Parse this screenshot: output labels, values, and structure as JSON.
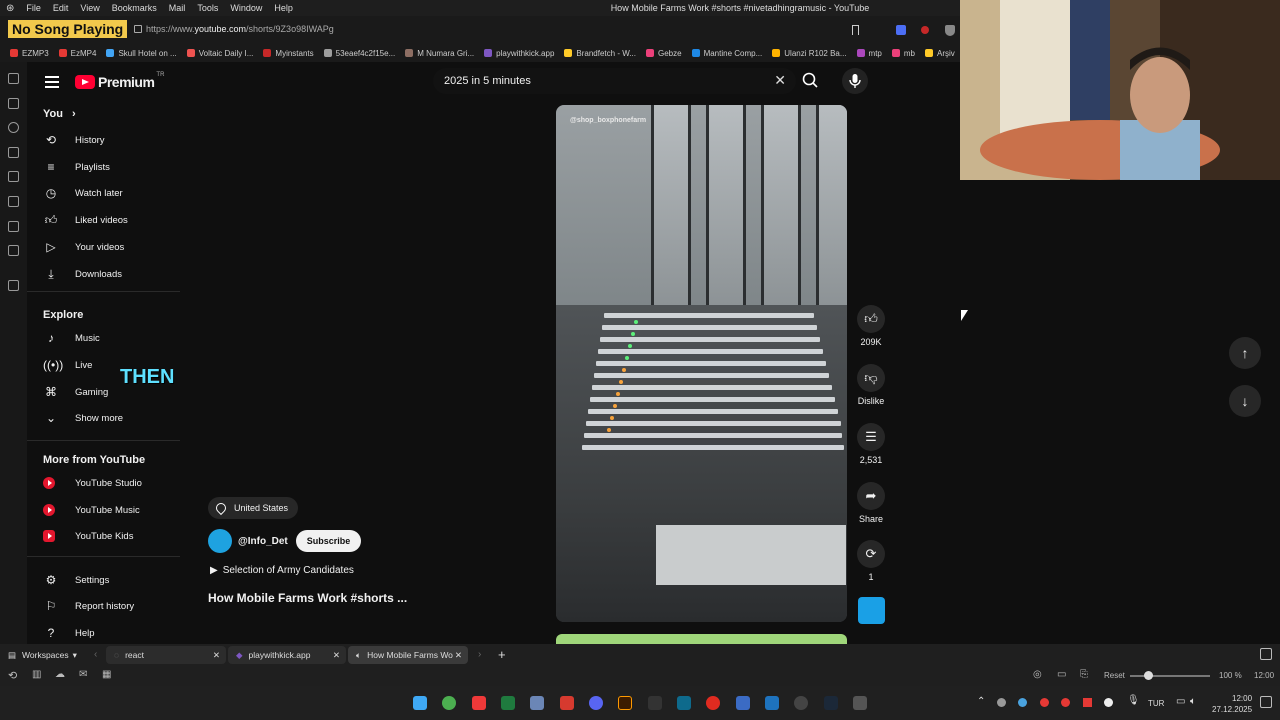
{
  "browser": {
    "menu": [
      "File",
      "Edit",
      "View",
      "Bookmarks",
      "Mail",
      "Tools",
      "Window",
      "Help"
    ],
    "window_title": "How Mobile Farms Work #shorts #nivetadhingramusic - YouTube",
    "url_prefix": "https://www.",
    "url_host": "youtube.com",
    "url_path": "/shorts/9Z3o98IWAPg",
    "overlay_label": "No Song Playing",
    "bookmarks": [
      "EZMP3",
      "EzMP4",
      "Skull Hotel on ...",
      "Voltaic Daily I...",
      "Myinstants",
      "53eaef4c2f15e...",
      "M Numara Gri...",
      "playwithkick.app",
      "Brandfetch - W...",
      "Gebze",
      "Mantine Comp...",
      "Ulanzi R102 Ba...",
      "mtp",
      "mb",
      "Arşiv"
    ],
    "bookmark_colors": [
      "#e53935",
      "#e53935",
      "#42a5f5",
      "#ef5350",
      "#c62828",
      "#9e9e9e",
      "#8d6e63",
      "#7e57c2",
      "#ffca28",
      "#ec407a",
      "#1e88e5",
      "#ffb300",
      "#ab47bc",
      "#ec407a",
      "#ffca28"
    ]
  },
  "sidebar": {
    "brand": "Premium",
    "region": "TR",
    "you_label": "You",
    "you_items": [
      {
        "icon": "history-icon",
        "label": "History"
      },
      {
        "icon": "playlists-icon",
        "label": "Playlists"
      },
      {
        "icon": "watch-later-icon",
        "label": "Watch later"
      },
      {
        "icon": "like-icon",
        "label": "Liked videos"
      },
      {
        "icon": "your-videos-icon",
        "label": "Your videos"
      },
      {
        "icon": "download-icon",
        "label": "Downloads"
      }
    ],
    "explore_label": "Explore",
    "explore_items": [
      {
        "icon": "music-note-icon",
        "label": "Music"
      },
      {
        "icon": "live-icon",
        "label": "Live"
      },
      {
        "icon": "gaming-icon",
        "label": "Gaming"
      },
      {
        "icon": "chevron-down-icon",
        "label": "Show more"
      }
    ],
    "more_label": "More from YouTube",
    "more_items": [
      {
        "label": "YouTube Studio"
      },
      {
        "label": "YouTube Music"
      },
      {
        "label": "YouTube Kids"
      }
    ],
    "bottom_items": [
      {
        "icon": "gear-icon",
        "label": "Settings"
      },
      {
        "icon": "flag-icon",
        "label": "Report history"
      },
      {
        "icon": "help-icon",
        "label": "Help"
      }
    ]
  },
  "search": {
    "value": "2025 in 5 minutes"
  },
  "short": {
    "overlay_handle": "@shop_boxphonefarm",
    "caption": "THEN",
    "location": "United States",
    "channel": "@Info_Det",
    "subscribe_label": "Subscribe",
    "playlist": "Selection of Army Candidates",
    "title": "How Mobile Farms Work #shorts ..."
  },
  "actions": {
    "likes": "209K",
    "dislike": "Dislike",
    "comments": "2,531",
    "share": "Share",
    "remix": "1"
  },
  "tabs": {
    "workspaces": "Workspaces",
    "items": [
      "react",
      "playwithkick.app",
      "How Mobile Farms Wo"
    ]
  },
  "status": {
    "reset": "Reset",
    "zoom": "100 %",
    "time": "12:00"
  },
  "taskbar": {
    "lang": "TUR",
    "time": "12:00",
    "date": "27.12.2025"
  },
  "colors": {
    "youtube_red": "#ff0033",
    "background": "#0f0f0f",
    "caption_cyan": "#5ee0ff",
    "overlay_yellow": "#f2c94c"
  }
}
